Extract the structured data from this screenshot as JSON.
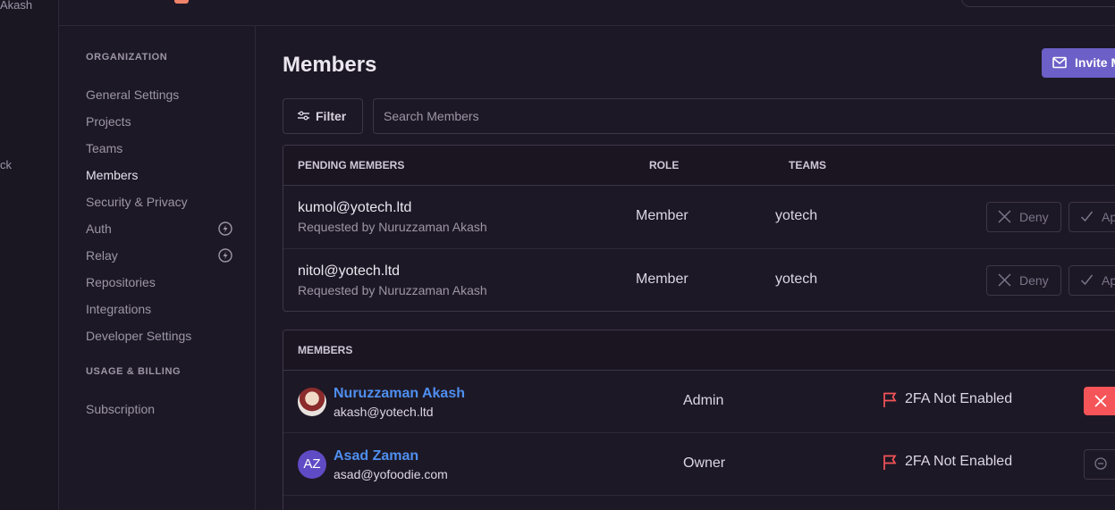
{
  "rail": {
    "user_partial": "Akash",
    "back_partial": "ck"
  },
  "sidebar": {
    "headings": {
      "organization": "ORGANIZATION",
      "usage_billing": "USAGE & BILLING"
    },
    "items": [
      {
        "label": "General Settings"
      },
      {
        "label": "Projects"
      },
      {
        "label": "Teams"
      },
      {
        "label": "Members",
        "active": true
      },
      {
        "label": "Security & Privacy"
      },
      {
        "label": "Auth",
        "icon": "lightning-icon"
      },
      {
        "label": "Relay",
        "icon": "lightning-icon"
      },
      {
        "label": "Repositories"
      },
      {
        "label": "Integrations"
      },
      {
        "label": "Developer Settings"
      }
    ],
    "billing_items": [
      {
        "label": "Subscription"
      }
    ]
  },
  "main": {
    "title": "Members",
    "invite_label": "Invite M",
    "filter_label": "Filter",
    "search_placeholder": "Search Members"
  },
  "pending": {
    "headers": {
      "member": "PENDING MEMBERS",
      "role": "ROLE",
      "teams": "TEAMS"
    },
    "rows": [
      {
        "email": "kumol@yotech.ltd",
        "requested_by": "Requested by Nuruzzaman Akash",
        "role": "Member",
        "team": "yotech",
        "deny": "Deny",
        "approve": "Ap"
      },
      {
        "email": "nitol@yotech.ltd",
        "requested_by": "Requested by Nuruzzaman Akash",
        "role": "Member",
        "team": "yotech",
        "deny": "Deny",
        "approve": "Ap"
      }
    ]
  },
  "members": {
    "header": "MEMBERS",
    "rows": [
      {
        "name": "Nuruzzaman Akash",
        "email": "akash@yotech.ltd",
        "role": "Admin",
        "twofa": "2FA Not Enabled",
        "avatar": "photo"
      },
      {
        "name": "Asad Zaman",
        "email": "asad@yofoodie.com",
        "role": "Owner",
        "twofa": "2FA Not Enabled",
        "initials": "AZ"
      }
    ]
  },
  "colors": {
    "accent": "#6c5fc7",
    "link": "#4e8ff0",
    "danger": "#f55459",
    "background": "#1d1825"
  }
}
